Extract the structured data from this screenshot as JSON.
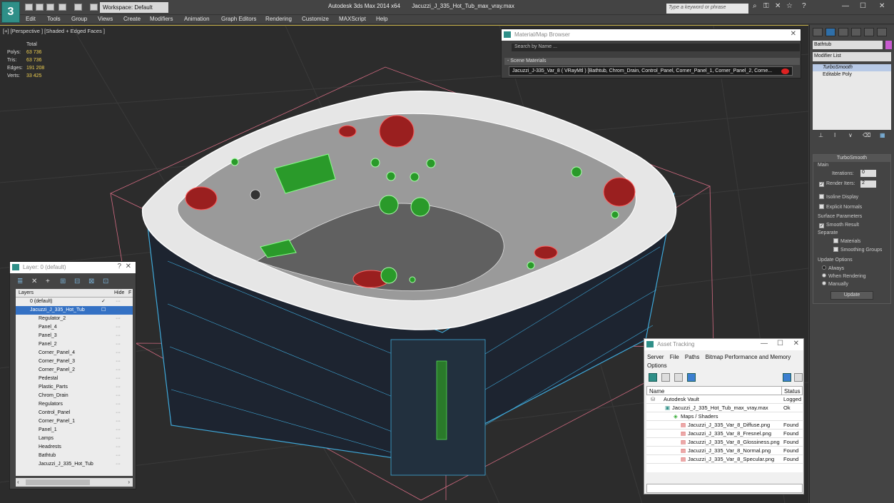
{
  "app": {
    "logo": "3",
    "title": "Autodesk 3ds Max  2014 x64",
    "file": "Jacuzzi_J_335_Hot_Tub_max_vray.max"
  },
  "toolbar": {
    "workspace": "Workspace: Default",
    "search_placeholder": "Type a keyword or phrase"
  },
  "menu": [
    "Edit",
    "Tools",
    "Group",
    "Views",
    "Create",
    "Modifiers",
    "Animation",
    "Graph Editors",
    "Rendering",
    "Customize",
    "MAXScript",
    "Help"
  ],
  "viewport": {
    "label": "[+] [Perspective ] [Shaded + Edged Faces ]",
    "stats": {
      "header": "Total",
      "polys_label": "Polys:",
      "polys": "63 736",
      "tris_label": "Tris:",
      "tris": "63 736",
      "edges_label": "Edges:",
      "edges": "191 208",
      "verts_label": "Verts:",
      "verts": "33 425"
    }
  },
  "command_panel": {
    "object_name": "Bathtub",
    "object_color": "#c85ad0",
    "modifier_list": "Modifier List",
    "stack": [
      "TurboSmooth",
      "Editable Poly"
    ],
    "rollout_title": "TurboSmooth",
    "main_label": "Main",
    "iterations_label": "Iterations:",
    "iterations": "0",
    "render_iters_label": "Render Iters:",
    "render_iters": "2",
    "isoline": "Isoline Display",
    "explicit": "Explicit Normals",
    "surface_label": "Surface Parameters",
    "smooth_result": "Smooth Result",
    "separate_label": "Separate",
    "materials": "Materials",
    "smoothing_groups": "Smoothing Groups",
    "update_options": "Update Options",
    "always": "Always",
    "when_rendering": "When Rendering",
    "manually": "Manually",
    "update_btn": "Update"
  },
  "material_browser": {
    "title": "Material/Map Browser",
    "search": "Search by Name ...",
    "section": "- Scene Materials",
    "row": "Jacuzzi_J-335_Var_8  ( VRayMtl )  [Bathtub, Chrom_Drain, Control_Panel, Corner_Panel_1, Corner_Panel_2, Corne..."
  },
  "layer_panel": {
    "title": "Layer: 0 (default)",
    "col_layers": "Layers",
    "col_hide": "Hide",
    "col_f": "F",
    "rows": [
      "0 (default)",
      "Jacuzzi_J_335_Hot_Tub",
      "Regulator_2",
      "Panel_4",
      "Panel_3",
      "Panel_2",
      "Corner_Panel_4",
      "Corner_Panel_3",
      "Corner_Panel_2",
      "Pedestal",
      "Plastic_Parts",
      "Chrom_Drain",
      "Regulators",
      "Control_Panel",
      "Corner_Panel_1",
      "Panel_1",
      "Lamps",
      "Headrests",
      "Bathtub",
      "Jacuzzi_J_335_Hot_Tub"
    ]
  },
  "asset_tracking": {
    "title": "Asset Tracking",
    "menu": [
      "Server",
      "File",
      "Paths",
      "Bitmap Performance and Memory",
      "Options"
    ],
    "col_name": "Name",
    "col_status": "Status",
    "rows": [
      {
        "name": "Autodesk Vault",
        "status": "Logged"
      },
      {
        "name": "Jacuzzi_J_335_Hot_Tub_max_vray.max",
        "status": "Ok"
      },
      {
        "name": "Maps / Shaders",
        "status": ""
      },
      {
        "name": "Jacuzzi_J_335_Var_8_Diffuse.png",
        "status": "Found"
      },
      {
        "name": "Jacuzzi_J_335_Var_8_Fresnel.png",
        "status": "Found"
      },
      {
        "name": "Jacuzzi_J_335_Var_8_Glossiness.png",
        "status": "Found"
      },
      {
        "name": "Jacuzzi_J_335_Var_8_Normal.png",
        "status": "Found"
      },
      {
        "name": "Jacuzzi_J_335_Var_8_Specular.png",
        "status": "Found"
      }
    ]
  }
}
